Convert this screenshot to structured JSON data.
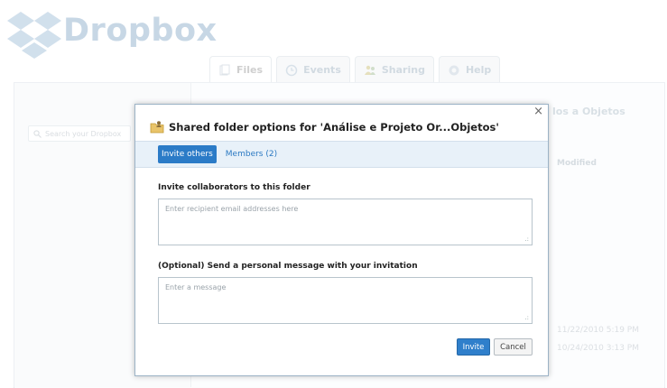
{
  "logo": {
    "text": "Dropbox"
  },
  "tabs": [
    {
      "label": "Files",
      "icon": "files-icon"
    },
    {
      "label": "Events",
      "icon": "events-icon"
    },
    {
      "label": "Sharing",
      "icon": "sharing-icon"
    },
    {
      "label": "Help",
      "icon": "help-icon"
    }
  ],
  "sidebar": {
    "search_placeholder": "Search your Dropbox"
  },
  "background": {
    "folder_title": "los a Objetos",
    "column_modified": "Modified",
    "dates": [
      "11/22/2010 5:19 PM",
      "10/24/2010 3:13 PM"
    ]
  },
  "dialog": {
    "title": "Shared folder options for 'Análise e Projeto Or...Objetos'",
    "close_symbol": "×",
    "tabs": {
      "invite": "Invite others",
      "members": "Members (2)"
    },
    "invite_label": "Invite collaborators to this folder",
    "invite_placeholder": "Enter recipient email addresses here",
    "message_label": "(Optional) Send a personal message with your invitation",
    "message_placeholder": "Enter a message",
    "invite_button": "Invite",
    "cancel_button": "Cancel"
  },
  "colors": {
    "accent": "#2b7bc7",
    "tab_bar": "#e8f1f9",
    "logo": "#a9c2d8"
  }
}
